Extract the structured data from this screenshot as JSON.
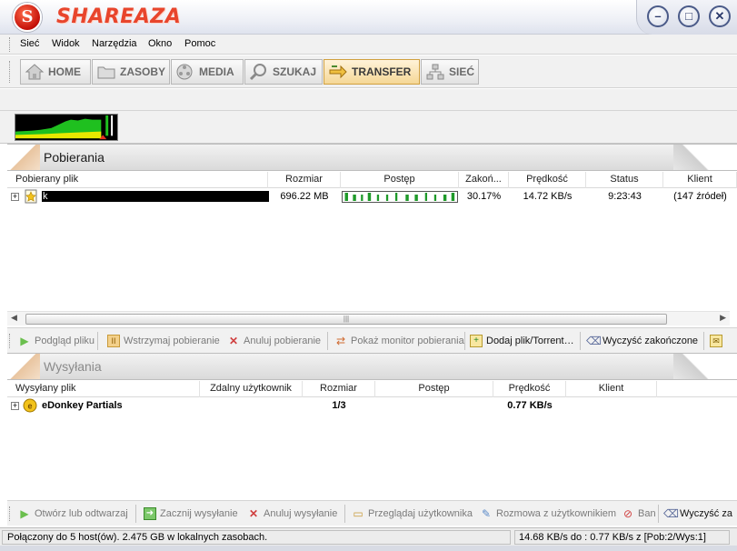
{
  "app": {
    "title": "SHAREAZA",
    "logo_letter": "S"
  },
  "menu": [
    "Sieć",
    "Widok",
    "Narzędzia",
    "Okno",
    "Pomoc"
  ],
  "nav": {
    "buttons": [
      {
        "label": "HOME",
        "icon": "house-icon"
      },
      {
        "label": "ZASOBY",
        "icon": "folder-icon"
      },
      {
        "label": "MEDIA",
        "icon": "film-reel-icon"
      },
      {
        "label": "SZUKAJ",
        "icon": "magnifier-icon"
      },
      {
        "label": "TRANSFER",
        "icon": "transfer-arrows-icon"
      },
      {
        "label": "SIEĆ",
        "icon": "network-icon"
      }
    ],
    "active": "TRANSFER"
  },
  "downloads": {
    "title": "Pobierania",
    "columns": [
      "Pobierany plik",
      "Rozmiar",
      "Postęp",
      "Zakoń...",
      "Prędkość",
      "Status",
      "Klient"
    ],
    "rows": [
      {
        "name": "k",
        "size": "696.22 MB",
        "progress": 0.3017,
        "completed": "30.17%",
        "speed": "14.72 KB/s",
        "status": "9:23:43",
        "client": "(147 źródeł)"
      }
    ],
    "actions": [
      {
        "label": "Podgląd pliku",
        "icon": "play-icon",
        "enabled": false
      },
      {
        "label": "Wstrzymaj pobieranie",
        "icon": "pause-icon",
        "enabled": false
      },
      {
        "label": "Anuluj pobieranie",
        "icon": "cancel-x-icon",
        "enabled": false
      },
      {
        "label": "Pokaż monitor pobierania",
        "icon": "monitor-icon",
        "enabled": false
      },
      {
        "label": "Dodaj plik/Torrent…",
        "icon": "add-file-icon",
        "enabled": true
      },
      {
        "label": "Wyczyść zakończone",
        "icon": "broom-icon",
        "enabled": true
      }
    ]
  },
  "uploads": {
    "title": "Wysyłania",
    "columns": [
      "Wysyłany plik",
      "Zdalny użytkownik",
      "Rozmiar",
      "Postęp",
      "Prędkość",
      "Klient"
    ],
    "rows": [
      {
        "name": "eDonkey Partials",
        "size": "1/3",
        "speed": "0.77 KB/s"
      }
    ],
    "actions": [
      {
        "label": "Otwórz lub odtwarzaj",
        "icon": "play-icon",
        "enabled": false
      },
      {
        "label": "Zacznij wysyłanie",
        "icon": "start-upload-icon",
        "enabled": false
      },
      {
        "label": "Anuluj wysyłanie",
        "icon": "cancel-x-icon",
        "enabled": false
      },
      {
        "label": "Przeglądaj użytkownika",
        "icon": "browse-folder-icon",
        "enabled": false
      },
      {
        "label": "Rozmowa z użytkownikiem",
        "icon": "chat-icon",
        "enabled": false
      },
      {
        "label": "Ban",
        "icon": "ban-icon",
        "enabled": false
      },
      {
        "label": "Wyczyść za",
        "icon": "broom-icon",
        "enabled": true
      }
    ]
  },
  "status": {
    "left": "Połączony do 5 host(ów). 2.475 GB w lokalnych zasobach.",
    "right": "14.68 KB/s do : 0.77 KB/s z [Pob:2/Wys:1]"
  },
  "colors": {
    "accent": "#e8452c",
    "graph_green": "#1fc01f",
    "graph_yellow": "#e8e800"
  }
}
